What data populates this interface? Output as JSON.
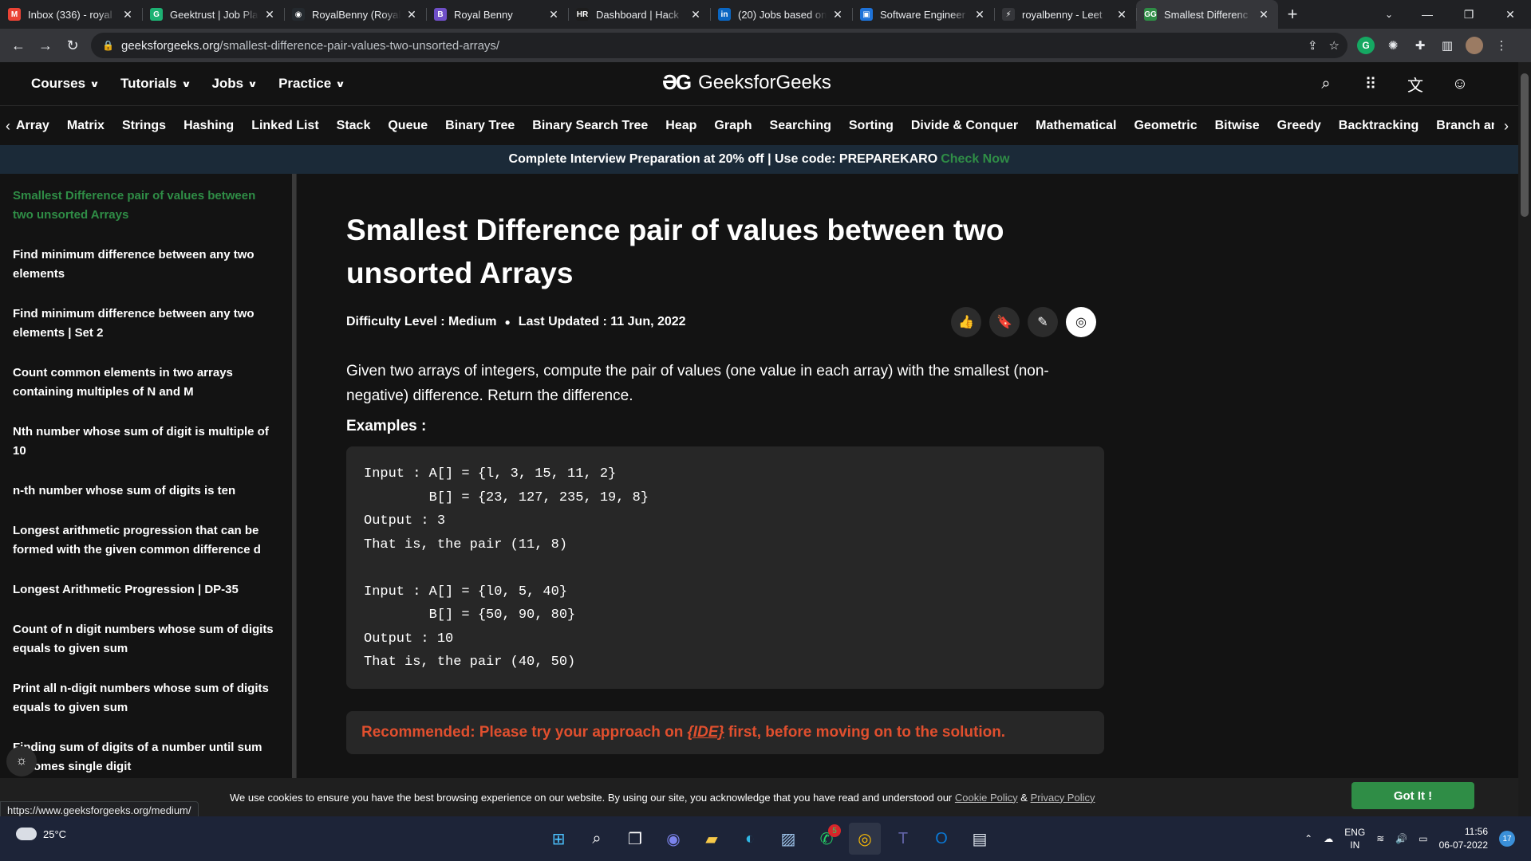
{
  "browser": {
    "tabs": [
      {
        "title": "Inbox (336) - royal",
        "favicon": "M",
        "favicon_color": "#ea4335",
        "active": false
      },
      {
        "title": "Geektrust | Job Pla",
        "favicon": "G",
        "favicon_color": "#1db173",
        "active": false
      },
      {
        "title": "RoyalBenny (Royal",
        "favicon": "◉",
        "favicon_color": "#24292e",
        "active": false
      },
      {
        "title": "Royal Benny",
        "favicon": "B",
        "favicon_color": "#6f4fc7",
        "active": false
      },
      {
        "title": "Dashboard | Hack",
        "favicon": "HR",
        "favicon_color": "#1d1d1d",
        "active": false
      },
      {
        "title": "(20) Jobs based on",
        "favicon": "in",
        "favicon_color": "#0a66c2",
        "active": false
      },
      {
        "title": "Software Engineer",
        "favicon": "▣",
        "favicon_color": "#1e72d8",
        "active": false
      },
      {
        "title": "royalbenny - Leet",
        "favicon": "⚡",
        "favicon_color": "#35363a",
        "active": false
      },
      {
        "title": "Smallest Differenc",
        "favicon": "GG",
        "favicon_color": "#2f8d46",
        "active": true
      }
    ],
    "new_tab": "+",
    "url_domain": "geeksforgeeks.org",
    "url_path": "/smallest-difference-pair-values-two-unsorted-arrays/",
    "status_url": "https://www.geeksforgeeks.org/medium/"
  },
  "header": {
    "logo_text": "GeeksforGeeks",
    "logo_mark": "ƏG",
    "menu": [
      {
        "label": "Courses"
      },
      {
        "label": "Tutorials"
      },
      {
        "label": "Jobs"
      },
      {
        "label": "Practice"
      }
    ]
  },
  "topics": [
    "Array",
    "Matrix",
    "Strings",
    "Hashing",
    "Linked List",
    "Stack",
    "Queue",
    "Binary Tree",
    "Binary Search Tree",
    "Heap",
    "Graph",
    "Searching",
    "Sorting",
    "Divide & Conquer",
    "Mathematical",
    "Geometric",
    "Bitwise",
    "Greedy",
    "Backtracking",
    "Branch and Bou"
  ],
  "promo": {
    "text": "Complete Interview Preparation at 20% off | Use code: PREPAREKARO",
    "cta": "Check Now"
  },
  "sidebar": {
    "links": [
      {
        "label": "Smallest Difference pair of values between two unsorted Arrays",
        "current": true
      },
      {
        "label": "Find minimum difference between any two elements",
        "current": false
      },
      {
        "label": "Find minimum difference between any two elements | Set 2",
        "current": false
      },
      {
        "label": "Count common elements in two arrays containing multiples of N and M",
        "current": false
      },
      {
        "label": "Nth number whose sum of digit is multiple of 10",
        "current": false
      },
      {
        "label": "n-th number whose sum of digits is ten",
        "current": false
      },
      {
        "label": "Longest arithmetic progression that can be formed with the given common difference d",
        "current": false
      },
      {
        "label": "Longest Arithmetic Progression | DP-35",
        "current": false
      },
      {
        "label": "Count of n digit numbers whose sum of digits equals to given sum",
        "current": false
      },
      {
        "label": "Print all n-digit numbers whose sum of digits equals to given sum",
        "current": false
      },
      {
        "label": "Finding sum of digits of a number until sum becomes single digit",
        "current": false
      }
    ]
  },
  "article": {
    "title": "Smallest Difference pair of values between two unsorted Arrays",
    "difficulty": "Difficulty Level : Medium",
    "updated": "Last Updated : 11 Jun, 2022",
    "description": "Given two arrays of integers, compute the pair of values (one value in each array) with the smallest (non-negative) difference. Return the difference.",
    "examples_label": "Examples :",
    "code_lines": [
      "Input : A[] = {l, 3, 15, 11, 2}",
      "        B[] = {23, 127, 235, 19, 8}",
      "Output : 3",
      "That is, the pair (11, 8)",
      "",
      "Input : A[] = {l0, 5, 40}",
      "        B[] = {50, 90, 80}",
      "Output : 10",
      "That is, the pair (40, 50)"
    ],
    "recommend_before": "Recommended: Please try your approach on",
    "recommend_link": "{IDE}",
    "recommend_after": "first, before moving on to the solution."
  },
  "cookie": {
    "text": "We use cookies to ensure you have the best browsing experience on our website. By using our site, you acknowledge that you have read and understood our",
    "cookie_policy": "Cookie Policy",
    "amp": "&",
    "privacy_policy": "Privacy Policy",
    "button": "Got It !"
  },
  "taskbar": {
    "weather": "25°C",
    "whatsapp_badge": "5",
    "lang_line1": "ENG",
    "lang_line2": "IN",
    "time": "11:56",
    "date": "06-07-2022",
    "notifications": "17"
  },
  "colors": {
    "gfg_green": "#2f8d46",
    "recommend_red": "#e04f2e",
    "promo_bg": "#1b2a38"
  }
}
